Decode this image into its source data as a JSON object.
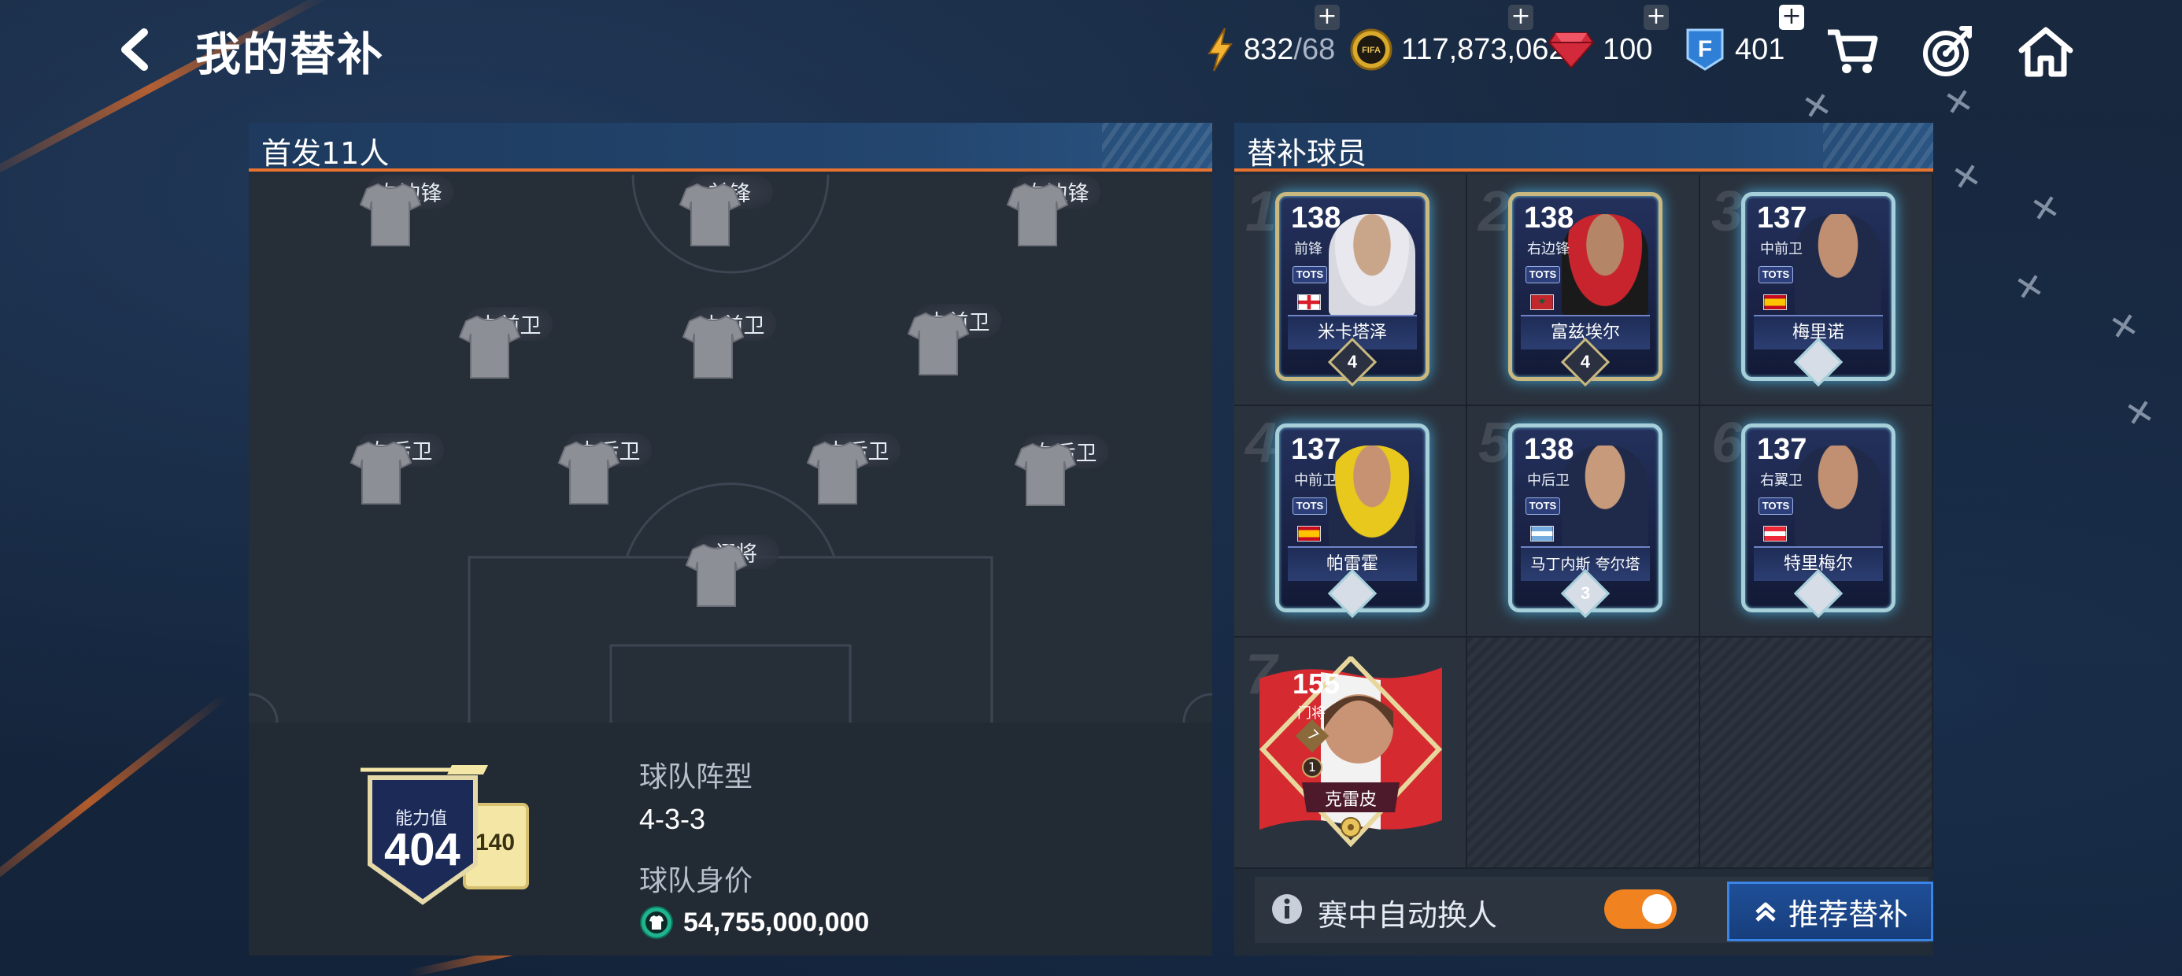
{
  "header": {
    "title": "我的替补",
    "resources": {
      "energy_current": "832",
      "energy_max": "/68",
      "coins": "117,873,062",
      "gems": "100",
      "fifa_points": "401"
    }
  },
  "lineup_panel": {
    "title": "首发11人",
    "players": [
      {
        "label": "左边锋"
      },
      {
        "label": "前锋"
      },
      {
        "label": "右边锋"
      },
      {
        "label": "中前卫"
      },
      {
        "label": "中前卫"
      },
      {
        "label": "中前卫"
      },
      {
        "label": "左后卫"
      },
      {
        "label": "中后卫"
      },
      {
        "label": "中后卫"
      },
      {
        "label": "右后卫"
      },
      {
        "label": "门将"
      }
    ],
    "team_rating": {
      "label": "能力值",
      "value": "404",
      "side_value": "140"
    },
    "formation_label": "球队阵型",
    "formation_value": "4-3-3",
    "value_label": "球队身价",
    "value_amount": "54,755,000,000"
  },
  "subs_panel": {
    "title": "替补球员",
    "slots": [
      {
        "num": "1",
        "rating": "138",
        "pos": "前锋",
        "tag": "TOTS",
        "name": "米卡塔泽",
        "chem": "4",
        "flag": "georgia"
      },
      {
        "num": "2",
        "rating": "138",
        "pos": "右边锋",
        "tag": "TOTS",
        "name": "富兹埃尔",
        "chem": "4",
        "flag": "morocco"
      },
      {
        "num": "3",
        "rating": "137",
        "pos": "中前卫",
        "tag": "TOTS",
        "name": "梅里诺",
        "chem": "",
        "flag": "spain"
      },
      {
        "num": "4",
        "rating": "137",
        "pos": "中前卫",
        "tag": "TOTS",
        "name": "帕雷霍",
        "chem": "",
        "flag": "spain"
      },
      {
        "num": "5",
        "rating": "138",
        "pos": "中后卫",
        "tag": "TOTS",
        "name": "马丁内斯 夸尔塔",
        "chem": "3",
        "flag": "argentina"
      },
      {
        "num": "6",
        "rating": "137",
        "pos": "右翼卫",
        "tag": "TOTS",
        "name": "特里梅尔",
        "chem": "",
        "flag": "austria"
      },
      {
        "num": "7",
        "rating": "155",
        "pos": "门将",
        "name": "克雷皮",
        "badge": "7",
        "rank": "1",
        "flag": "peru"
      }
    ],
    "auto_sub_label": "赛中自动换人",
    "auto_sub_on": true,
    "recommend_label": "推荐替补"
  },
  "colors": {
    "accent_orange": "#e8732e",
    "toggle_on": "#f0821f",
    "button_blue": "#1f4f98"
  }
}
